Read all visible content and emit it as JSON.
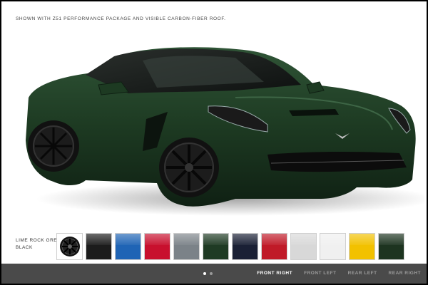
{
  "caption": "SHOWN WITH Z51 PERFORMANCE PACKAGE AND VISIBLE CARBON-FIBER ROOF.",
  "selected_color": {
    "name": "LIME ROCK GREEN",
    "trim": "BLACK"
  },
  "swatches": [
    {
      "name": "wheel",
      "icon": "wheel-icon",
      "color": "#ffffff"
    },
    {
      "name": "black",
      "color": "#1c1c1c"
    },
    {
      "name": "blue",
      "color": "#1f64b5"
    },
    {
      "name": "red",
      "color": "#c8102e"
    },
    {
      "name": "gray",
      "color": "#7b8288"
    },
    {
      "name": "green",
      "color": "#1f3b24"
    },
    {
      "name": "navy",
      "color": "#1a2035"
    },
    {
      "name": "crimson",
      "color": "#c01a28"
    },
    {
      "name": "silver",
      "color": "#d8d8d8"
    },
    {
      "name": "white",
      "color": "#f0f0f0"
    },
    {
      "name": "yellow",
      "color": "#f2c100"
    },
    {
      "name": "lime-rock-green",
      "color": "#1d3420"
    }
  ],
  "pagination": {
    "count": 2,
    "active": 0
  },
  "views": [
    {
      "label": "FRONT RIGHT",
      "active": true
    },
    {
      "label": "FRONT LEFT",
      "active": false
    },
    {
      "label": "REAR LEFT",
      "active": false
    },
    {
      "label": "REAR RIGHT",
      "active": false
    }
  ],
  "colors": {
    "body": "#1d3a22",
    "bottom_bar": "#4a4a4a"
  }
}
